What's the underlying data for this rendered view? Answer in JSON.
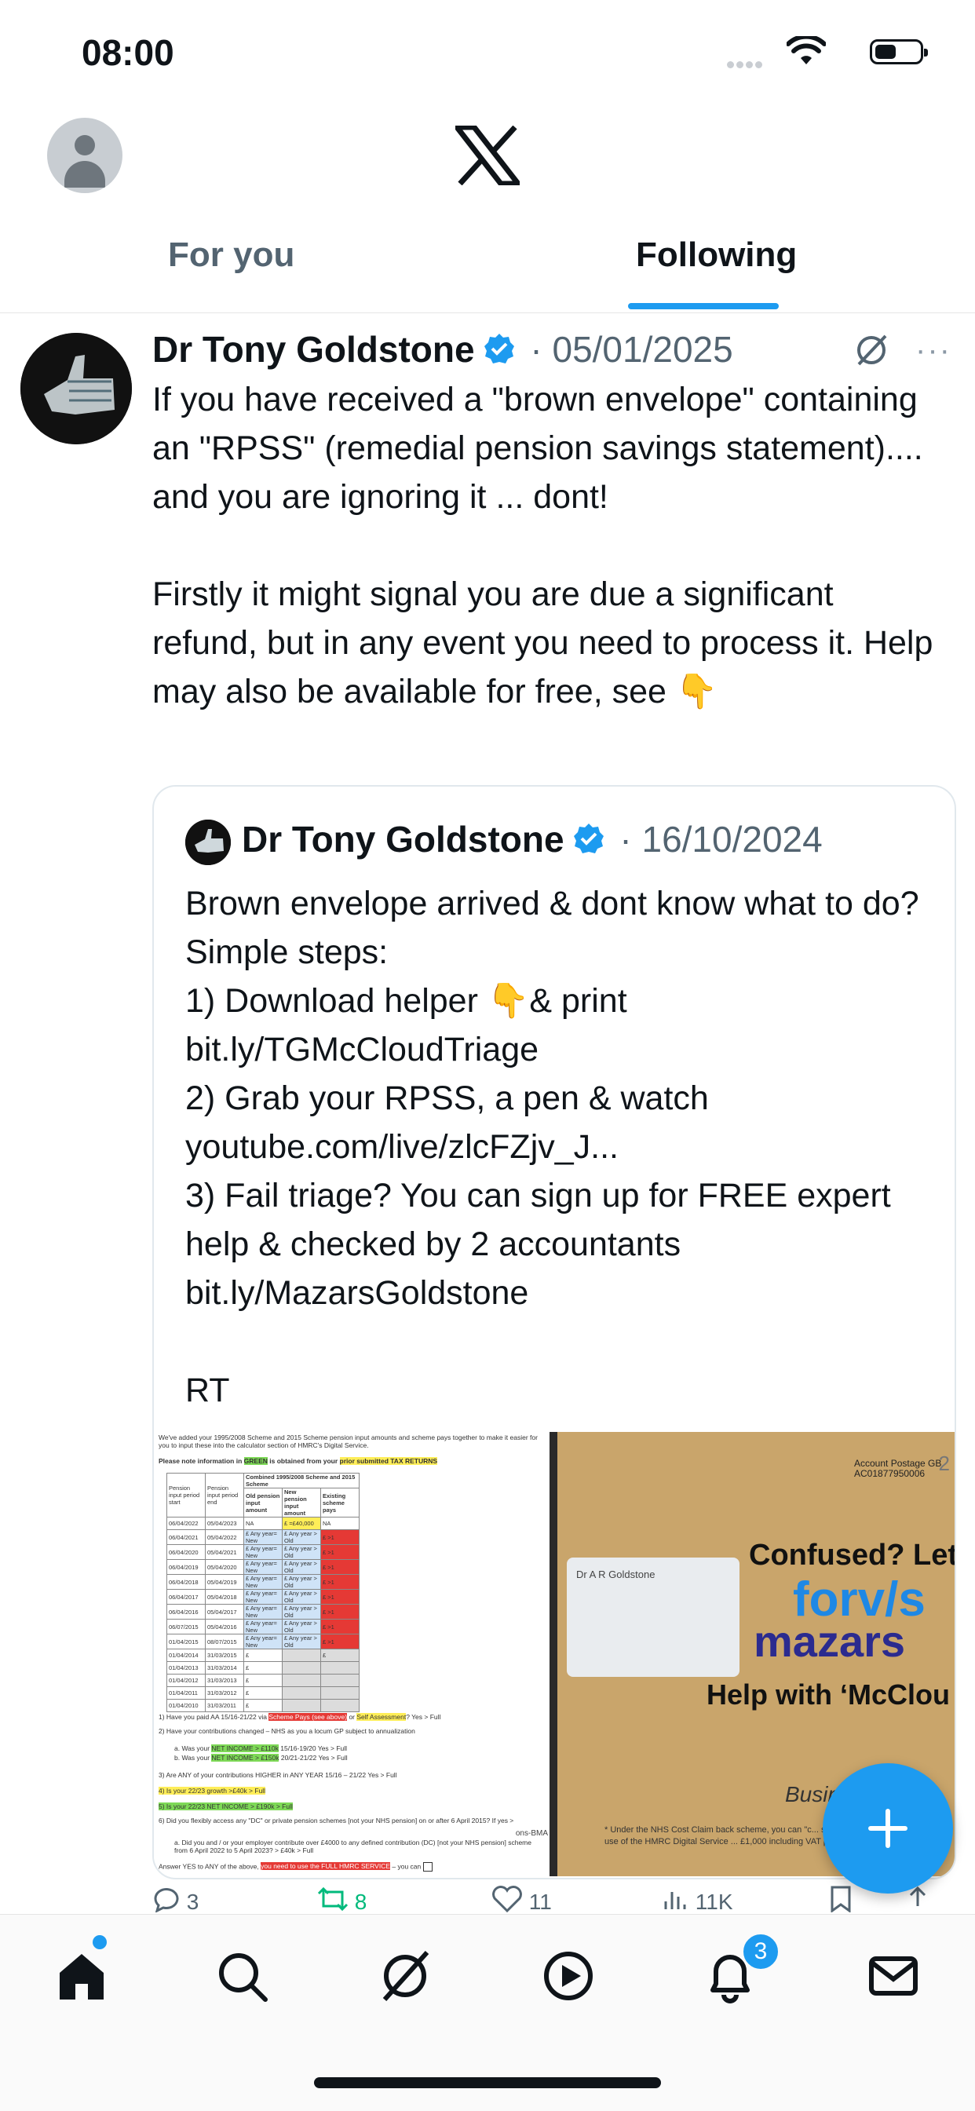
{
  "status_bar": {
    "time": "08:00"
  },
  "header": {
    "tabs": [
      {
        "label": "For you",
        "selected": false
      },
      {
        "label": "Following",
        "selected": true
      }
    ],
    "accent_color": "#1d9bf0"
  },
  "tweet": {
    "author": "Dr Tony Goldstone",
    "verified": true,
    "date": "05/01/2025",
    "text": "If you have received a \"brown envelope\" containing an \"RPSS\" (remedial pension savings statement).... and you are ignoring it ... dont!\n\nFirstly it might signal you are due a significant refund, but in any event you need to process it. Help may also be available for free, see 👇",
    "quote": {
      "author": "Dr Tony Goldstone",
      "verified": true,
      "date": "16/10/2024",
      "text": "Brown envelope arrived & dont know what to do? Simple steps:\n1) Download helper 👇& print\nbit.ly/TGMcCloudTriage\n2) Grab your RPSS, a pen & watch\nyoutube.com/live/zlcFZjv_J...\n3) Fail triage? You can sign up for FREE expert help & checked by 2 accountants\nbit.ly/MazarsGoldstone\n\nRT",
      "media": {
        "document": {
          "intro": "We've added your 1995/2008 Scheme and 2015 Scheme pension input amounts and scheme pays together to make it easier for you to input these into the calculator section of HMRC's Digital Service.",
          "note_prefix": "Please note information in",
          "note_green": "GREEN",
          "note_mid": "is obtained from your",
          "note_yellow": "prior submitted TAX RETURNS",
          "table_headers": [
            "Pension input period start",
            "Pension input period end",
            "Old pension input amount",
            "New pension input amount",
            "Existing scheme pays"
          ],
          "combined_header": "Combined 1995/2008 Scheme and 2015 Scheme",
          "rows": [
            [
              "06/04/2022",
              "05/04/2023",
              "NA",
              "£ =£40,000",
              "NA"
            ],
            [
              "06/04/2021",
              "05/04/2022",
              "£ Any year= New",
              "£ Any year > Old",
              "£ >1"
            ],
            [
              "06/04/2020",
              "05/04/2021",
              "£ Any year= New",
              "£ Any year > Old",
              "£ >1"
            ],
            [
              "06/04/2019",
              "05/04/2020",
              "£ Any year= New",
              "£ Any year > Old",
              "£ >1"
            ],
            [
              "06/04/2018",
              "05/04/2019",
              "£ Any year= New",
              "£ Any year > Old",
              "£ >1"
            ],
            [
              "06/04/2017",
              "05/04/2018",
              "£ Any year= New",
              "£ Any year > Old",
              "£ >1"
            ],
            [
              "06/04/2016",
              "05/04/2017",
              "£ Any year= New",
              "£ Any year > Old",
              "£ >1"
            ],
            [
              "06/07/2015",
              "05/04/2016",
              "£ Any year= New",
              "£ Any year > Old",
              "£ >1"
            ],
            [
              "01/04/2015",
              "08/07/2015",
              "£ Any year= New",
              "£ Any year > Old",
              "£ >1"
            ],
            [
              "01/04/2014",
              "31/03/2015",
              "£",
              "",
              "£"
            ],
            [
              "01/04/2013",
              "31/03/2014",
              "£",
              "",
              ""
            ],
            [
              "01/04/2012",
              "31/03/2013",
              "£",
              "",
              ""
            ],
            [
              "01/04/2011",
              "31/03/2012",
              "£",
              "",
              ""
            ],
            [
              "01/04/2010",
              "31/03/2011",
              "£",
              "",
              ""
            ]
          ],
          "q1_a": "1)  Have you paid AA 15/16-21/22 via",
          "q1_red": "Scheme Pays (see above)",
          "q1_b": "or",
          "q1_yellow": "Self Assessment",
          "q1_c": "? Yes > Full",
          "q2": "2)  Have your contributions changed – NHS as you a locum GP subject to annualization",
          "q2a_a": "a.  Was your",
          "q2a_green": "NET INCOME > £110k",
          "q2a_b": "15/16-19/20 Yes > Full",
          "q2b_a": "b.  Was your",
          "q2b_green": "NET INCOME > £150k",
          "q2b_b": "20/21-21/22 Yes > Full",
          "q3": "3)  Are ANY of your contributions HIGHER in ANY YEAR 15/16 – 21/22 Yes > Full",
          "q4": "4)  Is your 22/23 growth >£40k > Full",
          "q5": "5)  Is your 22/23 NET INCOME > £190k > Full",
          "q6": "6)  Did you flexibly access any \"DC\" or private pension schemes [not your NHS pension] on or after 6 April 2015? If yes >",
          "q6a": "a.  Did you and / or your employer contribute over £4000 to any defined contribution (DC) [not your NHS pension] scheme from 6 April 2022 to 5 April 2023? > £40k > Full",
          "answer_a": "Answer YES to ANY of the above,",
          "answer_red": "you need to use the FULL HMRC SERVICE",
          "answer_b": "– you can",
          "side_text": "ons-BMA"
        },
        "envelope": {
          "addressee": "Dr A R Goldstone",
          "postage": "Account Postage GB  AC01877950006",
          "postage_class": "2",
          "headline": "Confused? Let",
          "brand_top": "forv/s",
          "brand_bottom": "mazars",
          "help_line": "Help with ‘McClou",
          "business_word": "Busin",
          "fine_print": "* Under the NHS Cost Claim back scheme, you can \"c... service relates to the use of the HMRC Digital Service ... £1,000 including VAT per piece of advice\""
        }
      }
    },
    "actions": {
      "replies": "3",
      "reposts": "8",
      "likes": "11",
      "views": "11K"
    }
  },
  "tab_bar": {
    "items": [
      "home-icon",
      "search-icon",
      "grok-icon",
      "video-icon",
      "notifications-icon",
      "messages-icon"
    ],
    "notifications_count": "3"
  }
}
